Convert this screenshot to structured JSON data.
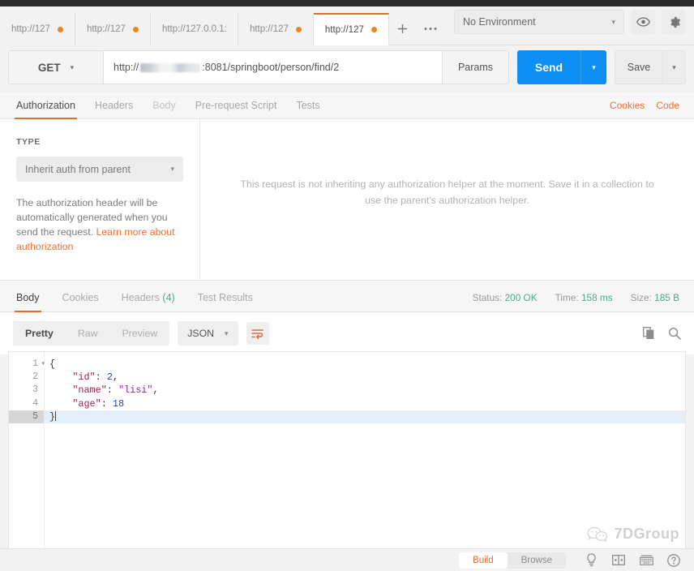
{
  "window": {
    "app": "Postman"
  },
  "tabs": {
    "items": [
      {
        "label": "http://127",
        "unsaved": true,
        "active": false
      },
      {
        "label": "http://127",
        "unsaved": true,
        "active": false
      },
      {
        "label": "http://127.0.0.1:",
        "unsaved": false,
        "active": false
      },
      {
        "label": "http://127",
        "unsaved": true,
        "active": false
      },
      {
        "label": "http://127",
        "unsaved": true,
        "active": true
      }
    ],
    "new_tab_icon": "plus-icon",
    "more_icon": "ellipsis-icon"
  },
  "environment": {
    "selected": "No Environment",
    "caret": "▾",
    "eye_icon": "eye-icon",
    "settings_icon": "gear-icon"
  },
  "request": {
    "method": "GET",
    "method_caret": "▾",
    "url_prefix": "http://",
    "url_suffix": ":8081/springboot/person/find/2",
    "url_redacted": true,
    "params_label": "Params",
    "send_label": "Send",
    "send_caret": "▾",
    "save_label": "Save",
    "save_caret": "▾",
    "tabs": [
      {
        "label": "Authorization",
        "active": true,
        "dim": false
      },
      {
        "label": "Headers",
        "active": false,
        "dim": false
      },
      {
        "label": "Body",
        "active": false,
        "dim": true
      },
      {
        "label": "Pre-request Script",
        "active": false,
        "dim": false
      },
      {
        "label": "Tests",
        "active": false,
        "dim": false
      }
    ],
    "cookies_link": "Cookies",
    "code_link": "Code"
  },
  "authorization": {
    "type_label": "TYPE",
    "type_value": "Inherit auth from parent",
    "type_caret": "▾",
    "description_plain": "The authorization header will be automatically generated when you send the request. ",
    "description_link": "Learn more about authorization",
    "empty_note": "This request is not inheriting any authorization helper at the moment. Save it in a collection to use the parent's authorization helper."
  },
  "response": {
    "tabs": [
      {
        "label": "Body",
        "count": "",
        "active": true
      },
      {
        "label": "Cookies",
        "count": "",
        "active": false
      },
      {
        "label": "Headers",
        "count": "(4)",
        "active": false
      },
      {
        "label": "Test Results",
        "count": "",
        "active": false
      }
    ],
    "status_label": "Status:",
    "status_value": "200 OK",
    "time_label": "Time:",
    "time_value": "158 ms",
    "size_label": "Size:",
    "size_value": "185 B",
    "view_modes": [
      {
        "label": "Pretty",
        "active": true
      },
      {
        "label": "Raw",
        "active": false
      },
      {
        "label": "Preview",
        "active": false
      }
    ],
    "format": "JSON",
    "format_caret": "▾",
    "wrap_icon": "word-wrap-icon",
    "copy_icon": "copy-icon",
    "search_icon": "search-icon",
    "body_lines": [
      {
        "n": "1",
        "fold": true,
        "current": false,
        "tokens": [
          {
            "t": "{",
            "c": "brace"
          }
        ]
      },
      {
        "n": "2",
        "fold": false,
        "current": false,
        "tokens": [
          {
            "t": "    \"id\"",
            "c": "key"
          },
          {
            "t": ": ",
            "c": "plain"
          },
          {
            "t": "2",
            "c": "num"
          },
          {
            "t": ",",
            "c": "plain"
          }
        ]
      },
      {
        "n": "3",
        "fold": false,
        "current": false,
        "tokens": [
          {
            "t": "    \"name\"",
            "c": "key"
          },
          {
            "t": ": ",
            "c": "plain"
          },
          {
            "t": "\"lisi\"",
            "c": "str"
          },
          {
            "t": ",",
            "c": "plain"
          }
        ]
      },
      {
        "n": "4",
        "fold": false,
        "current": false,
        "tokens": [
          {
            "t": "    \"age\"",
            "c": "key"
          },
          {
            "t": ": ",
            "c": "plain"
          },
          {
            "t": "18",
            "c": "num"
          }
        ]
      },
      {
        "n": "5",
        "fold": false,
        "current": true,
        "tokens": [
          {
            "t": "}",
            "c": "brace"
          }
        ]
      }
    ]
  },
  "watermark": {
    "text": "7DGroup",
    "icon": "wechat-icon"
  },
  "statusbar": {
    "build_label": "Build",
    "browse_label": "Browse",
    "bulb_icon": "lightbulb-icon",
    "layout_icon": "two-pane-icon",
    "keyboard_icon": "keyboard-icon",
    "help_icon": "help-icon"
  }
}
